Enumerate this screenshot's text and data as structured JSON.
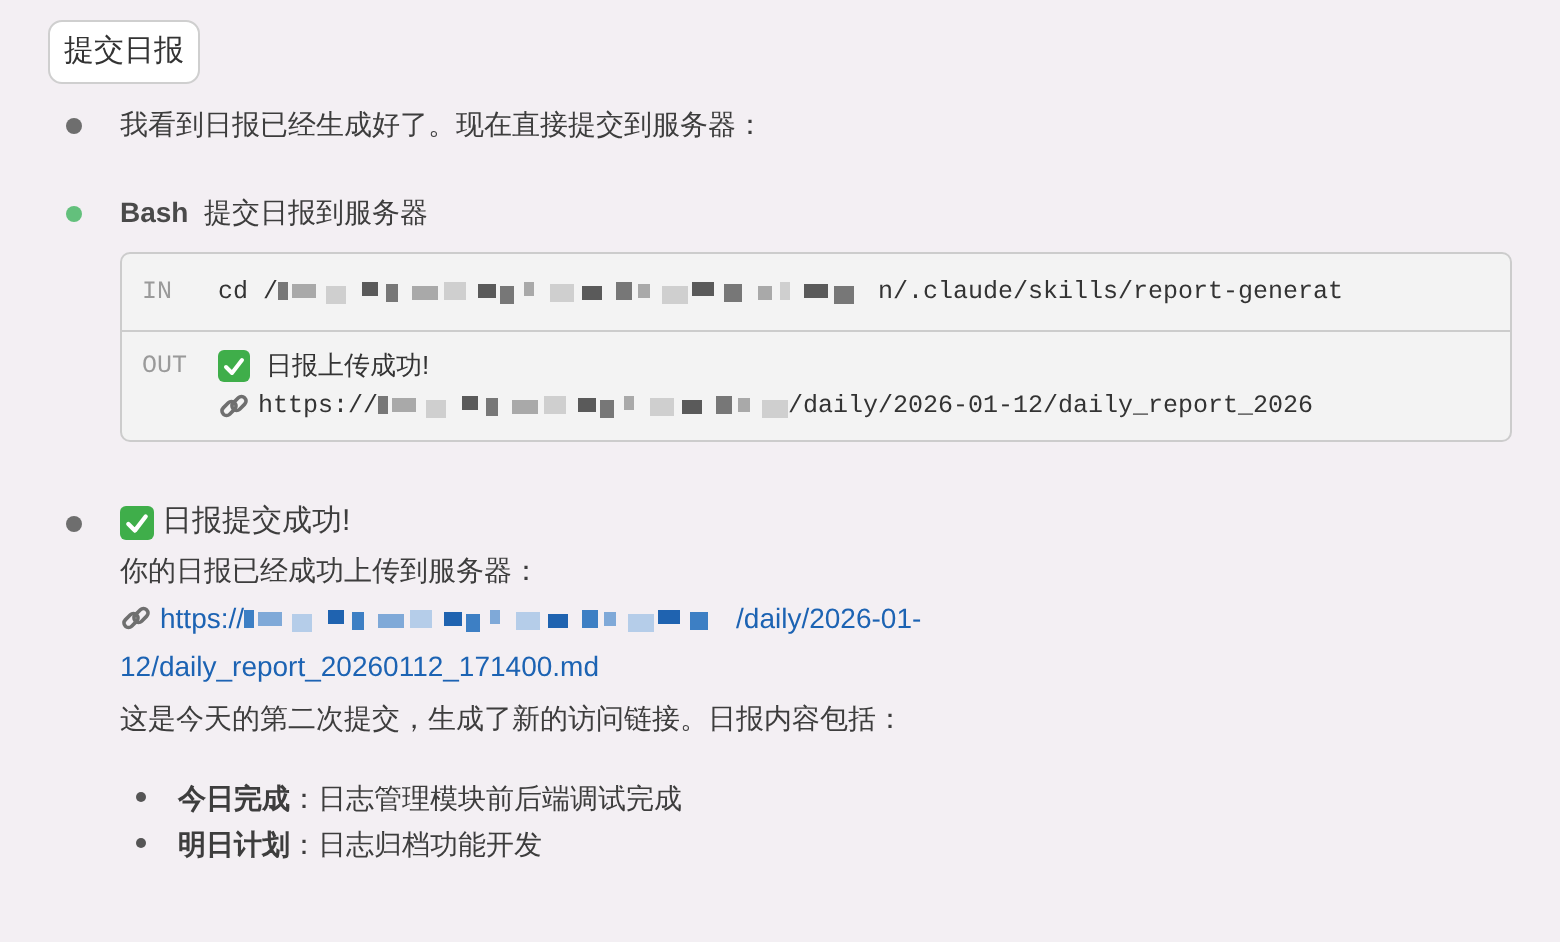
{
  "prompt_button": "提交日报",
  "messages": [
    {
      "kind": "text",
      "color": "#6e6e6e",
      "text": "我看到日报已经生成好了。现在直接提交到服务器："
    },
    {
      "kind": "tool",
      "color": "#63c07c",
      "tool": "Bash",
      "description": "提交日报到服务器",
      "input": {
        "label": "IN",
        "prefix": "cd /",
        "suffix": "n/.claude/skills/report-generat"
      },
      "output": {
        "label": "OUT",
        "lines": [
          {
            "kind": "status",
            "text": "日报上传成功!"
          },
          {
            "kind": "link",
            "prefix": "https://",
            "suffix": "/daily/2026-01-12/daily_report_2026"
          }
        ]
      }
    },
    {
      "kind": "result",
      "color": "#6e6e6e",
      "heading": "日报提交成功!",
      "paragraph": "你的日报已经成功上传到服务器：",
      "link": {
        "prefix": "https://",
        "suffix": "/daily/2026-01-12/daily_report_20260112_171400.md"
      },
      "note": "这是今天的第二次提交，生成了新的访问链接。日报内容包括：",
      "list": [
        "**今日完成**：日志管理模块前后端调试完成",
        "**明日计划**：日志归档功能开发"
      ]
    }
  ]
}
